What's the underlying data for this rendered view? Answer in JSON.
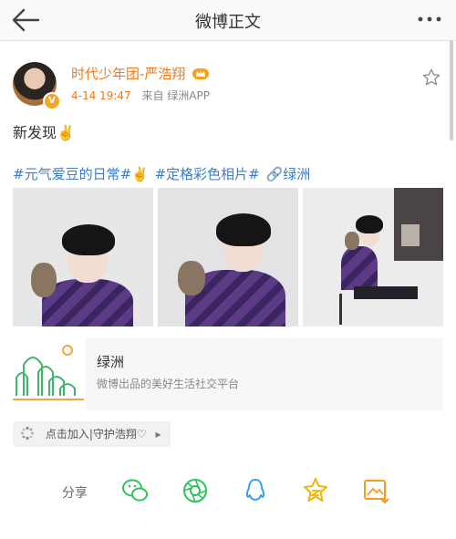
{
  "header": {
    "title": "微博正文",
    "back_icon": "arrow-left-icon",
    "more_icon": "more-dots-icon"
  },
  "post": {
    "username": "时代少年团-严浩翔",
    "time": "4-14 19:47",
    "source": "来自 绿洲APP",
    "text": "新发现✌️",
    "tags": [
      "#元气爱豆的日常#✌️",
      "#定格彩色相片#",
      "🔗绿洲"
    ],
    "verified_badge": "V",
    "colors": {
      "username": "#f2791c",
      "link": "#3f7cc7"
    }
  },
  "card": {
    "title": "绿洲",
    "subtitle": "微博出品的美好生活社交平台"
  },
  "chip": {
    "label": "点击加入|守护浩翔♡"
  },
  "share": {
    "label": "分享",
    "icons": [
      "wechat-icon",
      "moments-icon",
      "qq-icon",
      "qzone-icon",
      "save-image-icon"
    ]
  }
}
